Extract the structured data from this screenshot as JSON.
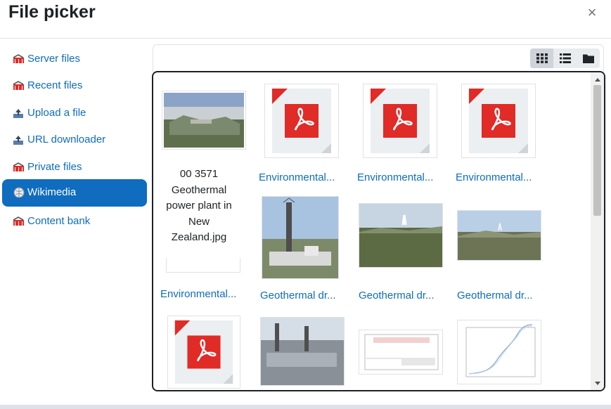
{
  "dialog": {
    "title": "File picker",
    "close_icon": "×"
  },
  "sidebar": {
    "items": [
      {
        "label": "Server files",
        "icon": "moodle-icon"
      },
      {
        "label": "Recent files",
        "icon": "moodle-icon"
      },
      {
        "label": "Upload a file",
        "icon": "upload-icon"
      },
      {
        "label": "URL downloader",
        "icon": "url-downloader-icon"
      },
      {
        "label": "Private files",
        "icon": "moodle-icon"
      },
      {
        "label": "Wikimedia",
        "icon": "wikimedia-globe-icon",
        "active": true
      },
      {
        "label": "Content bank",
        "icon": "moodle-icon"
      }
    ]
  },
  "toolbar": {
    "views": [
      "icons-view",
      "list-view",
      "tree-view"
    ],
    "active_view": "icons-view"
  },
  "files": [
    {
      "name": "Environmental...",
      "type": "pdf"
    },
    {
      "name": "Environmental...",
      "type": "pdf"
    },
    {
      "name": "Environmental...",
      "type": "pdf"
    },
    {
      "name": "Environmental...",
      "type": "pdf"
    },
    {
      "name": "Geothermal dr...",
      "type": "photo"
    },
    {
      "name": "Geothermal dr...",
      "type": "photo"
    },
    {
      "name": "Geothermal dr...",
      "type": "photo"
    }
  ],
  "first_item": {
    "tooltip": "00 3571 Geothermal power plant in New Zealand.jpg"
  },
  "colors": {
    "accent": "#0f6cbf",
    "text": "#1d2125",
    "pdf_red": "#e02b27"
  }
}
